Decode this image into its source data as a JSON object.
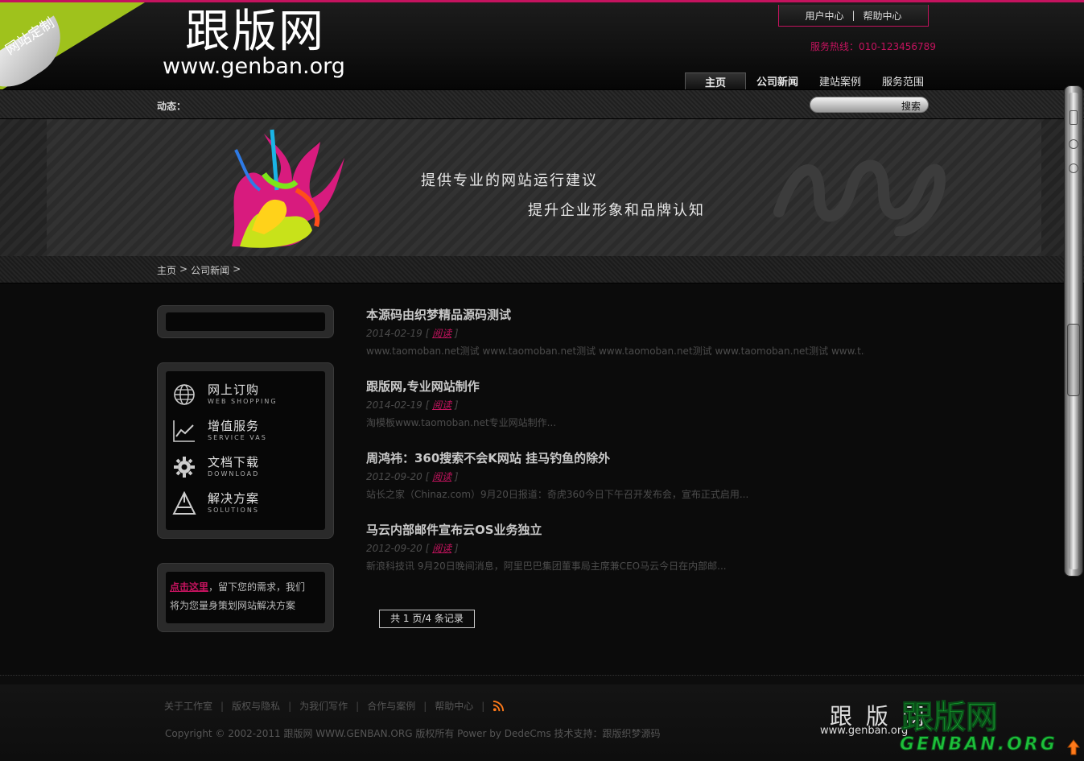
{
  "ribbon": {
    "text": "网站定制"
  },
  "logo": {
    "name": "跟版网",
    "domain": "www.genban.org"
  },
  "topbar": {
    "user_center": "用户中心",
    "separator": "|",
    "help_center": "帮助中心"
  },
  "hotline": "服务热线：010-123456789",
  "nav": {
    "items": [
      {
        "label": "主页"
      },
      {
        "label": "公司新闻"
      },
      {
        "label": "建站案例"
      },
      {
        "label": "服务范围"
      }
    ]
  },
  "news_bar": {
    "label": "动态：",
    "search_button": "搜索"
  },
  "banner": {
    "slogan1": "提供专业的网站运行建议",
    "slogan2": "提升企业形象和品牌认知"
  },
  "breadcrumb": {
    "home": "主页",
    "sep": ">",
    "current": "公司新闻",
    "trail": ">"
  },
  "sidebar": {
    "items": [
      {
        "title": "网上订购",
        "subtitle": "WEB SHOPPING",
        "icon": "globe-icon"
      },
      {
        "title": "增值服务",
        "subtitle": "SERVICE VAS",
        "icon": "chart-icon"
      },
      {
        "title": "文档下载",
        "subtitle": "DOWNLOAD",
        "icon": "gear-icon"
      },
      {
        "title": "解决方案",
        "subtitle": "SOLUTIONS",
        "icon": "app-icon"
      }
    ],
    "contact": {
      "link": "点击这里",
      "text1": "，留下您的需求，我们",
      "text2": "将为您量身策划网站解决方案"
    }
  },
  "articles": [
    {
      "title": "本源码由织梦精品源码测试",
      "date": "2014-02-19",
      "read": "阅读",
      "desc": "www.taomoban.net测试 www.taomoban.net测试 www.taomoban.net测试 www.taomoban.net测试 www.t..."
    },
    {
      "title": "跟版网,专业网站制作",
      "date": "2014-02-19",
      "read": "阅读",
      "desc": "淘模板www.taomoban.net专业网站制作..."
    },
    {
      "title": "周鸿祎：360搜索不会K网站 挂马钓鱼的除外",
      "date": "2012-09-20",
      "read": "阅读",
      "desc": "站长之家（Chinaz.com）9月20日报道：奇虎360今日下午召开发布会，宣布正式启用..."
    },
    {
      "title": "马云内部邮件宣布云OS业务独立",
      "date": "2012-09-20",
      "read": "阅读",
      "desc": "新浪科技讯 9月20日晚间消息，阿里巴巴集团董事局主席兼CEO马云今日在内部邮..."
    }
  ],
  "pager": "共 1 页/4 条记录",
  "footer": {
    "links": [
      "关于工作室",
      "版权与隐私",
      "为我们写作",
      "合作与案例",
      "帮助中心"
    ],
    "copyright": "Copyright © 2002-2011 跟版网 WWW.GENBAN.ORG 版权所有 Power by DedeCms 技术支持：跟版织梦源码",
    "logo_cn": "跟 版 网",
    "logo_en": "www.genban.org",
    "watermark_cn": "跟版网",
    "watermark_en": "GENBAN.ORG"
  },
  "colors": {
    "accent": "#c4135e",
    "lime": "#9fc21c",
    "watermark": "#1dbf3a"
  }
}
